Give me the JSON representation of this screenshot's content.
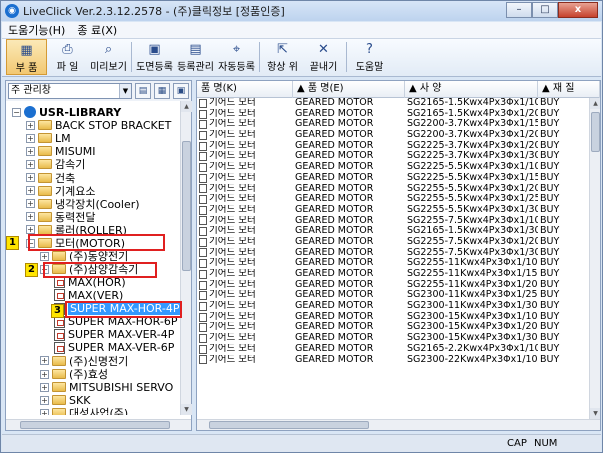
{
  "window": {
    "title": "LiveClick Ver.2.3.12.2578 - (주)클릭정보 [정품인증]",
    "minimize": "–",
    "maximize": "□",
    "close": "x"
  },
  "menu": [
    "도움기능(H)",
    "종 료(X)"
  ],
  "toolbar": [
    {
      "label": "부 품",
      "icon": "parts-icon",
      "glyph": "▦",
      "active": true
    },
    {
      "label": "파 일",
      "icon": "printer-icon",
      "glyph": "⎙",
      "active": false
    },
    {
      "label": "미리보기",
      "icon": "magnifier-icon",
      "glyph": "⌕",
      "active": false
    },
    {
      "label": "도면등록",
      "icon": "drawing-register-icon",
      "glyph": "▣",
      "active": false
    },
    {
      "label": "등록관리",
      "icon": "register-manage-icon",
      "glyph": "▤",
      "active": false
    },
    {
      "label": "자동등록",
      "icon": "auto-register-icon",
      "glyph": "⌖",
      "active": false
    },
    {
      "label": "항상 위",
      "icon": "always-on-top-icon",
      "glyph": "⇱",
      "active": false
    },
    {
      "label": "끝내기",
      "icon": "exit-icon",
      "glyph": "✕",
      "active": false
    },
    {
      "label": "도움말",
      "icon": "help-icon",
      "glyph": "?",
      "active": false
    }
  ],
  "left_panel": {
    "combo_value": "주 관리창",
    "tree": [
      {
        "label": "USR-LIBRARY",
        "level": 0,
        "type": "root",
        "expander": "−",
        "bold": true
      },
      {
        "label": "BACK STOP BRACKET",
        "level": 1,
        "type": "folder",
        "expander": "+"
      },
      {
        "label": "LM",
        "level": 1,
        "type": "folder",
        "expander": "+"
      },
      {
        "label": "MISUMI",
        "level": 1,
        "type": "folder",
        "expander": "+"
      },
      {
        "label": "감속기",
        "level": 1,
        "type": "folder",
        "expander": "+"
      },
      {
        "label": "건축",
        "level": 1,
        "type": "folder",
        "expander": "+"
      },
      {
        "label": "기계요소",
        "level": 1,
        "type": "folder",
        "expander": "+"
      },
      {
        "label": "냉각장치(Cooler)",
        "level": 1,
        "type": "folder",
        "expander": "+"
      },
      {
        "label": "동력전달",
        "level": 1,
        "type": "folder",
        "expander": "+"
      },
      {
        "label": "롤러(ROLLER)",
        "level": 1,
        "type": "folder",
        "expander": "+"
      },
      {
        "label": "모터(MOTOR)",
        "level": 1,
        "type": "folder",
        "expander": "−"
      },
      {
        "label": "(주)동양전기",
        "level": 2,
        "type": "folder",
        "expander": "+"
      },
      {
        "label": "(주)삼양감속기",
        "level": 2,
        "type": "folder",
        "expander": "−"
      },
      {
        "label": "MAX(HOR)",
        "level": 3,
        "type": "doc",
        "expander": ""
      },
      {
        "label": "MAX(VER)",
        "level": 3,
        "type": "doc",
        "expander": ""
      },
      {
        "label": "SUPER MAX-HOR-4P",
        "level": 3,
        "type": "doc",
        "expander": "",
        "selected": true
      },
      {
        "label": "SUPER MAX-HOR-6P",
        "level": 3,
        "type": "doc",
        "expander": ""
      },
      {
        "label": "SUPER MAX-VER-4P",
        "level": 3,
        "type": "doc",
        "expander": ""
      },
      {
        "label": "SUPER MAX-VER-6P",
        "level": 3,
        "type": "doc",
        "expander": ""
      },
      {
        "label": "(주)신명전기",
        "level": 2,
        "type": "folder",
        "expander": "+"
      },
      {
        "label": "(주)효성",
        "level": 2,
        "type": "folder",
        "expander": "+"
      },
      {
        "label": "MITSUBISHI SERVO",
        "level": 2,
        "type": "folder",
        "expander": "+"
      },
      {
        "label": "SKK",
        "level": 2,
        "type": "folder",
        "expander": "+"
      },
      {
        "label": "대성사업(주)",
        "level": 2,
        "type": "folder",
        "expander": "+"
      }
    ],
    "badges": [
      "1",
      "2",
      "3"
    ]
  },
  "grid": {
    "columns": [
      "품 명(K)",
      "품 명(E)",
      "사 양",
      "재 질"
    ],
    "rows": [
      [
        "기어드 모터",
        "GEARED MOTOR",
        "SG2165-1.5Kwx4Px3Φx1/10",
        "BUY"
      ],
      [
        "기어드 모터",
        "GEARED MOTOR",
        "SG2165-1.5Kwx4Px3Φx1/20",
        "BUY"
      ],
      [
        "기어드 모터",
        "GEARED MOTOR",
        "SG2200-3.7Kwx4Px3Φx1/15",
        "BUY"
      ],
      [
        "기어드 모터",
        "GEARED MOTOR",
        "SG2200-3.7Kwx4Px3Φx1/20",
        "BUY"
      ],
      [
        "기어드 모터",
        "GEARED MOTOR",
        "SG2225-3.7Kwx4Px3Φx1/20",
        "BUY"
      ],
      [
        "기어드 모터",
        "GEARED MOTOR",
        "SG2225-3.7Kwx4Px3Φx1/30",
        "BUY"
      ],
      [
        "기어드 모터",
        "GEARED MOTOR",
        "SG2225-5.5Kwx4Px3Φx1/10",
        "BUY"
      ],
      [
        "기어드 모터",
        "GEARED MOTOR",
        "SG2225-5.5Kwx4Px3Φx1/15",
        "BUY"
      ],
      [
        "기어드 모터",
        "GEARED MOTOR",
        "SG2255-5.5Kwx4Px3Φx1/20",
        "BUY"
      ],
      [
        "기어드 모터",
        "GEARED MOTOR",
        "SG2255-5.5Kwx4Px3Φx1/25",
        "BUY"
      ],
      [
        "기어드 모터",
        "GEARED MOTOR",
        "SG2255-5.5Kwx4Px3Φx1/30",
        "BUY"
      ],
      [
        "기어드 모터",
        "GEARED MOTOR",
        "SG2255-7.5Kwx4Px3Φx1/10",
        "BUY"
      ],
      [
        "기어드 모터",
        "GEARED MOTOR",
        "SG2165-1.5Kwx4Px3Φx1/30",
        "BUY"
      ],
      [
        "기어드 모터",
        "GEARED MOTOR",
        "SG2255-7.5Kwx4Px3Φx1/20",
        "BUY"
      ],
      [
        "기어드 모터",
        "GEARED MOTOR",
        "SG2255-7.5Kwx4Px3Φx1/30",
        "BUY"
      ],
      [
        "기어드 모터",
        "GEARED MOTOR",
        "SG2255-11Kwx4Px3Φx1/10",
        "BUY"
      ],
      [
        "기어드 모터",
        "GEARED MOTOR",
        "SG2255-11Kwx4Px3Φx1/15",
        "BUY"
      ],
      [
        "기어드 모터",
        "GEARED MOTOR",
        "SG2255-11Kwx4Px3Φx1/20",
        "BUY"
      ],
      [
        "기어드 모터",
        "GEARED MOTOR",
        "SG2300-11Kwx4Px3Φx1/25",
        "BUY"
      ],
      [
        "기어드 모터",
        "GEARED MOTOR",
        "SG2300-11Kwx4Px3Φx1/30",
        "BUY"
      ],
      [
        "기어드 모터",
        "GEARED MOTOR",
        "SG2300-15Kwx4Px3Φx1/10",
        "BUY"
      ],
      [
        "기어드 모터",
        "GEARED MOTOR",
        "SG2300-15Kwx4Px3Φx1/20",
        "BUY"
      ],
      [
        "기어드 모터",
        "GEARED MOTOR",
        "SG2300-15Kwx4Px3Φx1/30",
        "BUY"
      ],
      [
        "기어드 모터",
        "GEARED MOTOR",
        "SG2165-2.2Kwx4Px3Φx1/10",
        "BUY"
      ],
      [
        "기어드 모터",
        "GEARED MOTOR",
        "SG2300-22Kwx4Px3Φx1/10",
        "BUY"
      ]
    ]
  },
  "status": {
    "cap": "CAP",
    "num": "NUM"
  },
  "colors": {
    "selection": "#3399ff",
    "callout": "#e02020",
    "badge": "#ffe500"
  }
}
